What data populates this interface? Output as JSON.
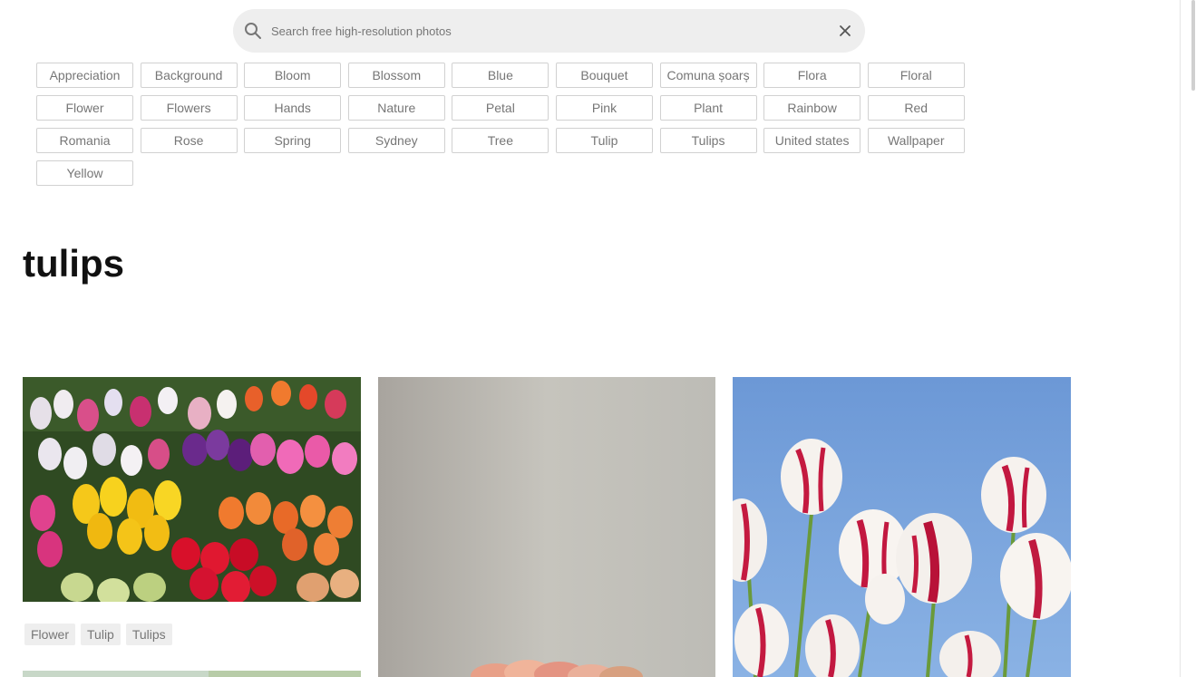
{
  "search": {
    "placeholder": "Search free high-resolution photos",
    "value": ""
  },
  "related_tags": [
    "Appreciation",
    "Background",
    "Bloom",
    "Blossom",
    "Blue",
    "Bouquet",
    "Comuna șoarș",
    "Flora",
    "Floral",
    "Flower",
    "Flowers",
    "Hands",
    "Nature",
    "Petal",
    "Pink",
    "Plant",
    "Rainbow",
    "Red",
    "Romania",
    "Rose",
    "Spring",
    "Sydney",
    "Tree",
    "Tulip",
    "Tulips",
    "United states",
    "Wallpaper",
    "Yellow"
  ],
  "page_title": "tulips",
  "photos": [
    {
      "tags": [
        "Flower",
        "Tulip",
        "Tulips"
      ]
    }
  ],
  "colors": {
    "search_bg": "#eeeeee",
    "tag_border": "#d1d1d1",
    "tag_text": "#767676",
    "title_text": "#111111",
    "photo_tag_bg": "#eeeeee"
  }
}
